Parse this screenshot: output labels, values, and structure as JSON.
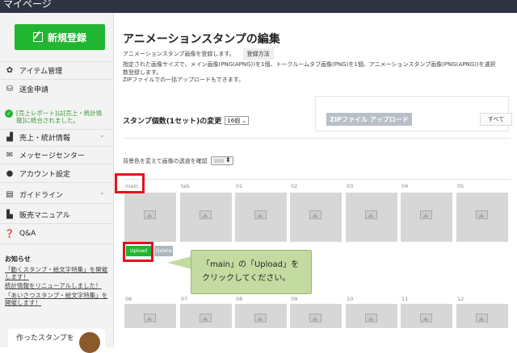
{
  "topbar": {
    "title": "マイページ"
  },
  "sidebar": {
    "new_button": "新規登録",
    "items": [
      {
        "label": "アイテム管理",
        "icon": "gear-icon"
      },
      {
        "label": "送金申請",
        "icon": "database-icon"
      },
      {
        "label": "売上・統計情報",
        "icon": "chart-icon",
        "has_chevron": true
      },
      {
        "label": "メッセージセンター",
        "icon": "mail-icon"
      },
      {
        "label": "アカウント設定",
        "icon": "user-icon"
      },
      {
        "label": "ガイドライン",
        "icon": "book-icon",
        "has_chevron": true
      },
      {
        "label": "販売マニュアル",
        "icon": "document-icon"
      },
      {
        "label": "Q&A",
        "icon": "question-icon"
      }
    ],
    "notice": "[売上レポート]は[売上・統計情報]に統合されました。",
    "news_title": "お知らせ",
    "news_links": [
      "「動くスタンプ・絵文字特集」を開催します！",
      "統計情報をリニューアルしました！",
      "「あいさつスタンプ・絵文字特集」を開催します！"
    ],
    "promo_text": "作ったスタンプを"
  },
  "main": {
    "title": "アニメーションスタンプの編集",
    "subtitle": "アニメーションスタンプ画像を登録します。",
    "how_to": "登録方法",
    "description_line1": "指定された画像サイズで、メイン画像(PNG(APNG))を1個、トークルームタブ画像(PNG)を1個、アニメーションスタンプ画像(PNG(APNG))を選択",
    "description_line2": "数登録します。",
    "description_line3": "ZIPファイルでの一括アップロードもできます。",
    "count_label": "スタンプ個数(1セット)の変更",
    "count_value": "16個",
    "zip_button": "ZIPファイル アップロード",
    "all_button": "すべて",
    "bg_label": "背景色を変えて画像の透過を確認",
    "row1_labels": [
      "main",
      "tab",
      "01",
      "02",
      "03",
      "04",
      "05"
    ],
    "row2_labels": [
      "06",
      "07",
      "08",
      "09",
      "10",
      "11",
      "12"
    ],
    "upload_button": "Upload",
    "delete_button": "Delete",
    "callout_line1": "「main」の「Upload」を",
    "callout_line2": "クリックしてください。",
    "accent_green": "#21b531",
    "highlight_red": "#e0141e"
  }
}
